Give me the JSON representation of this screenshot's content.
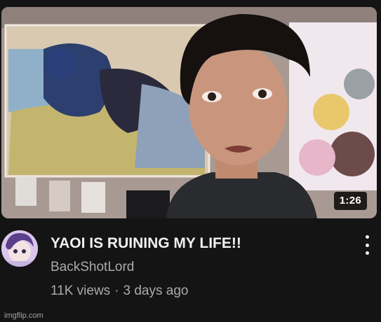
{
  "video": {
    "title": "YAOI IS RUINING MY LIFE!!",
    "channel": "BackShotLord",
    "views": "11K views",
    "age": "3 days ago",
    "duration": "1:26"
  },
  "icons": {
    "more": "more-vert-icon",
    "avatar": "channel-avatar"
  },
  "watermark": "imgflip.com",
  "colors": {
    "background": "#141414",
    "title": "#f1f1f1",
    "meta": "#aaaaaa"
  }
}
